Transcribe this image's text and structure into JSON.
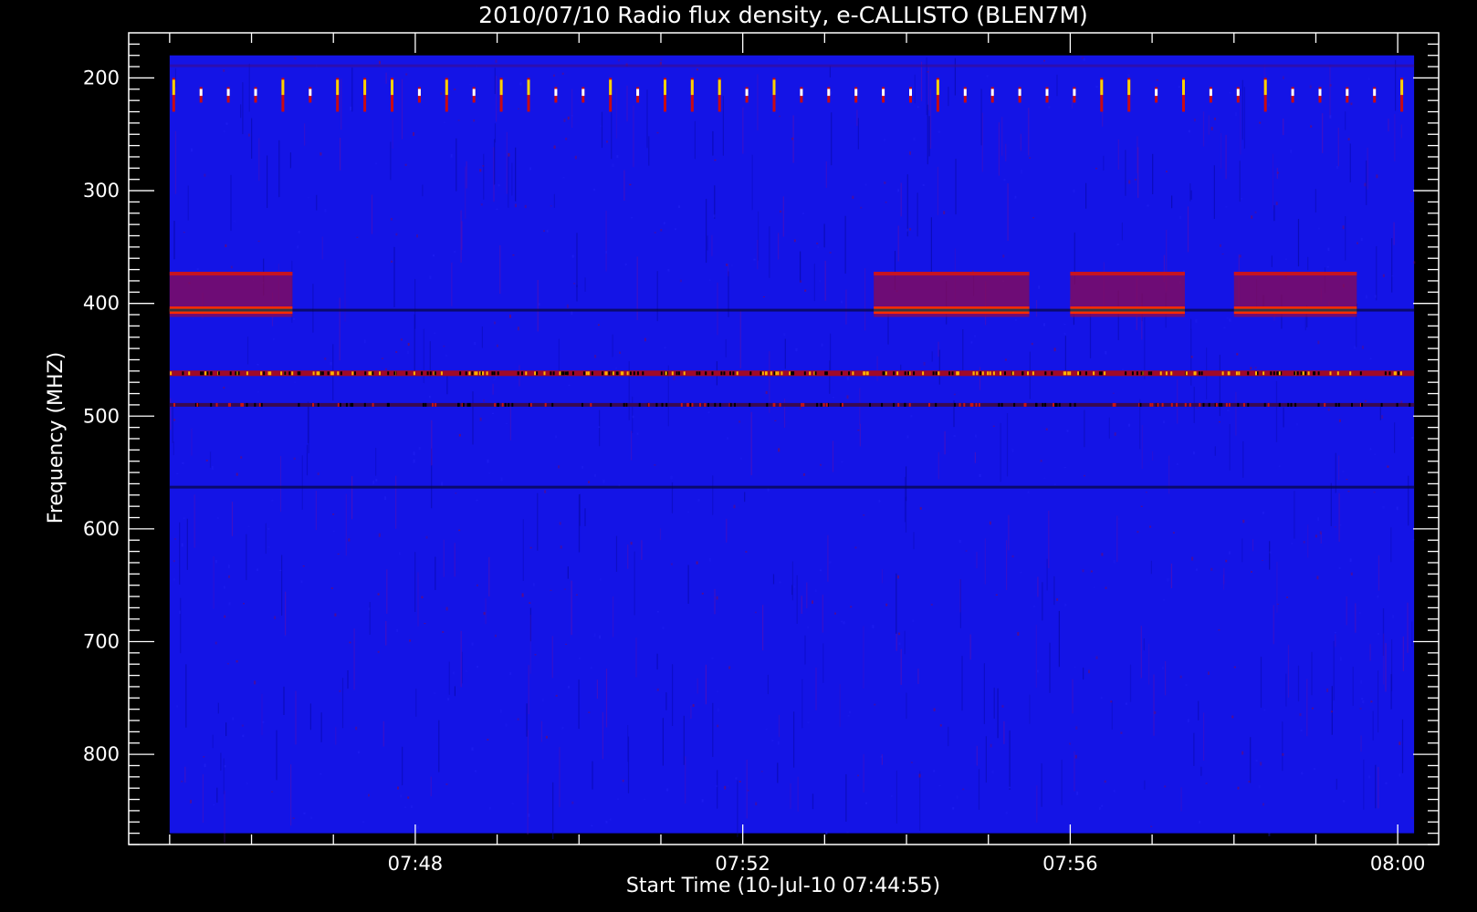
{
  "chart_data": {
    "type": "heatmap",
    "title": "2010/07/10  Radio flux density, e-CALLISTO (BLEN7M)",
    "xlabel": "Start Time (10-Jul-10 07:44:55)",
    "ylabel": "Frequency (MHZ)",
    "x_ticks": [
      "07:48",
      "07:52",
      "07:56",
      "08:00"
    ],
    "x_tick_minutes": [
      48,
      52,
      56,
      60
    ],
    "xlim_minutes": [
      45.0,
      60.2
    ],
    "x_axis_minutes": [
      44.5,
      60.5
    ],
    "y_ticks": [
      "200",
      "300",
      "400",
      "500",
      "600",
      "700",
      "800"
    ],
    "y_tick_values": [
      200,
      300,
      400,
      500,
      600,
      700,
      800
    ],
    "ylim": [
      180,
      870
    ],
    "y_axis": [
      160,
      880
    ],
    "y_inverted": true,
    "background_color": "#1414e6",
    "colormap": [
      "#000033",
      "#1010e0",
      "#8c0a50",
      "#ff0000",
      "#ffc800",
      "#ffffff"
    ],
    "features": [
      {
        "kind": "periodic-bursts",
        "freq_center": 215,
        "freq_width": 25,
        "period_s": 20,
        "t_start_min": 45.0,
        "t_end_min": 60.2
      },
      {
        "kind": "band",
        "freq_low": 372,
        "freq_high": 412,
        "peak_freq": 406,
        "t_start_min": 45.0,
        "t_end_min": 46.5
      },
      {
        "kind": "band",
        "freq_low": 372,
        "freq_high": 412,
        "peak_freq": 406,
        "t_start_min": 53.6,
        "t_end_min": 55.5
      },
      {
        "kind": "band",
        "freq_low": 372,
        "freq_high": 412,
        "peak_freq": 406,
        "t_start_min": 56.0,
        "t_end_min": 57.4
      },
      {
        "kind": "band",
        "freq_low": 372,
        "freq_high": 412,
        "peak_freq": 406,
        "t_start_min": 58.0,
        "t_end_min": 59.5
      },
      {
        "kind": "continuous-line",
        "freq": 462,
        "intensity": "high"
      },
      {
        "kind": "continuous-line",
        "freq": 490,
        "intensity": "medium"
      },
      {
        "kind": "dark-line",
        "freq": 406
      },
      {
        "kind": "dark-line",
        "freq": 563
      }
    ]
  }
}
